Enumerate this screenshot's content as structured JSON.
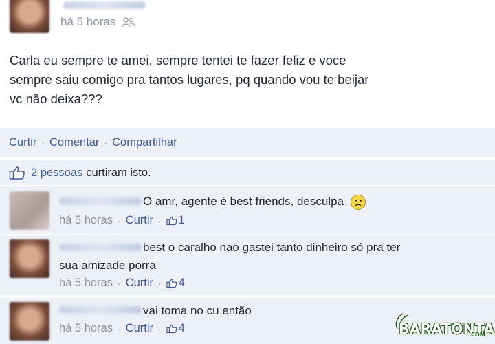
{
  "post": {
    "time": "há 5 horas",
    "audience_icon": "friends-icon",
    "text": "Carla eu sempre te amei, sempre tentei te fazer feliz e voce\nsempre saiu comigo pra tantos lugares, pq quando vou te beijar\nvc não deixa???"
  },
  "actions": {
    "like": "Curtir",
    "comment": "Comentar",
    "share": "Compartilhar",
    "separator": "·"
  },
  "likes": {
    "link_text": "2 pessoas",
    "rest_text": "curtiram isto."
  },
  "comments": [
    {
      "text": "O amr, agente é best friends, desculpa",
      "emoticon": "sad-face-icon",
      "time": "há 5 horas",
      "like_label": "Curtir",
      "like_count": "1"
    },
    {
      "text": "best o caralho nao gastei tanto dinheiro só pra ter\nsua amizade porra",
      "time": "há 5 horas",
      "like_label": "Curtir",
      "like_count": "4"
    },
    {
      "text": "vai toma no cu então",
      "time": "há 5 horas",
      "like_label": "Curtir",
      "like_count": "4"
    }
  ],
  "watermark": {
    "text": "BARATONTA",
    "suffix": ".COM"
  },
  "colors": {
    "link": "#3b5998",
    "meta": "#8d94a4",
    "panel": "#edf0f6"
  }
}
